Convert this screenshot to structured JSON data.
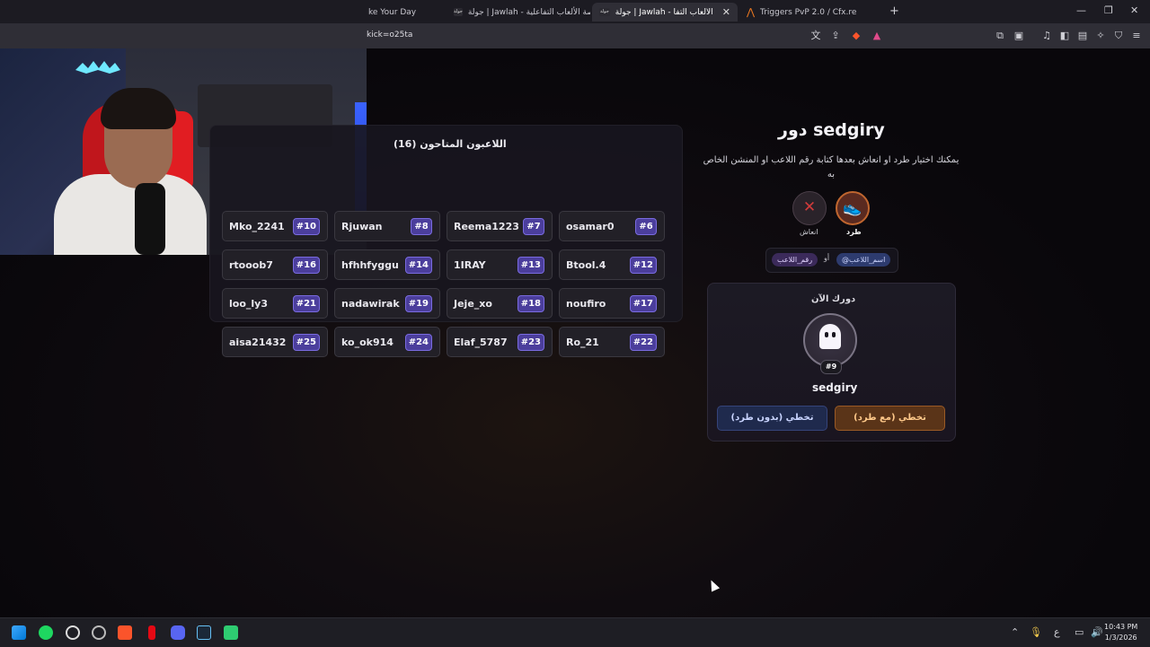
{
  "browser": {
    "tabs": [
      {
        "label": "ke Your Day",
        "active": false
      },
      {
        "label": "جولة | Jawlah - منصة الألعاب التفاعلية",
        "active": false,
        "favicon": "جولة"
      },
      {
        "label": "جولة | Jawlah - منصة الألعاب التفا",
        "active": true,
        "favicon": "جولة"
      },
      {
        "label": "Triggers PvP 2.0 / Cfx.re",
        "active": false
      }
    ],
    "url": "kick=o25ta",
    "new_tab_icon": "plus-icon"
  },
  "players_panel": {
    "title": "اللاعبون المتاحون (16)",
    "players": [
      {
        "name": "osamar0",
        "num": "#6"
      },
      {
        "name": "Reema1223",
        "num": "#7"
      },
      {
        "name": "Rjuwan",
        "num": "#8"
      },
      {
        "name": "Mko_2241",
        "num": "#10"
      },
      {
        "name": "Btool.4",
        "num": "#12"
      },
      {
        "name": "1IRAY",
        "num": "#13"
      },
      {
        "name": "hfhhfyggu",
        "num": "#14"
      },
      {
        "name": "rtooob7",
        "num": "#16"
      },
      {
        "name": "noufiro",
        "num": "#17"
      },
      {
        "name": "Jeje_xo",
        "num": "#18"
      },
      {
        "name": "nadawirak",
        "num": "#19"
      },
      {
        "name": "loo_ly3",
        "num": "#21"
      },
      {
        "name": "Ro_21",
        "num": "#22"
      },
      {
        "name": "Elaf_5787",
        "num": "#23"
      },
      {
        "name": "ko_ok914",
        "num": "#24"
      },
      {
        "name": "aisa21432",
        "num": "#25"
      }
    ]
  },
  "turn": {
    "title": "دور sedgiry",
    "description": "يمكنك اختيار طرد او انعاش بعدها كتابة رقم اللاعب او المنشن الخاص به",
    "actions": {
      "kick": "طرد",
      "revive": "انعاش"
    },
    "hint": {
      "name_tag": "@اسم_اللاعب",
      "or": "أو",
      "number_tag": "رقم_اللاعب"
    },
    "now_label": "دورك الآن",
    "current_player": {
      "name": "sedgiry",
      "num": "#9"
    },
    "skip_with_kick": "تخطي (مع طرد)",
    "skip_without_kick": "تخطي (بدون طرد)"
  },
  "taskbar": {
    "time": "10:43 PM",
    "date": "1/3/2026",
    "lang": "ع"
  },
  "colors": {
    "accent": "#4b3e9c",
    "kick": "#c0662f",
    "panel": "#18161e"
  }
}
